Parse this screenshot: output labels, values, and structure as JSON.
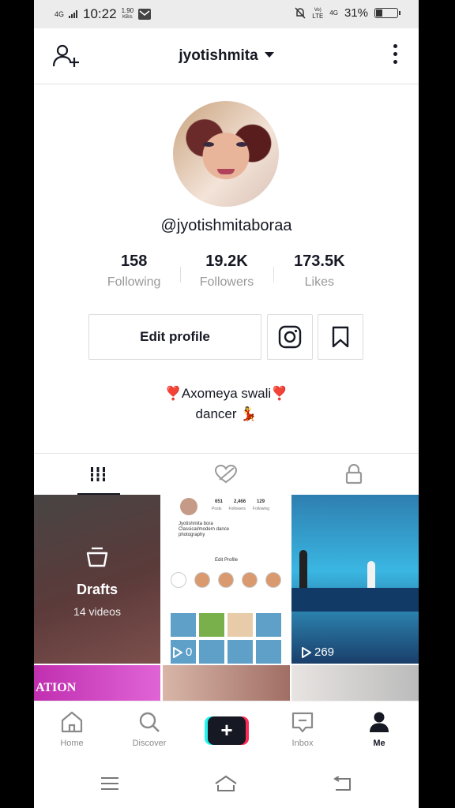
{
  "status_bar": {
    "network_left": "4G",
    "time": "10:22",
    "speed_value": "1.90",
    "speed_unit": "KB/s",
    "network_right_top": "Vo)",
    "network_right_bottom": "LTE",
    "network_right_gen": "4G",
    "battery_percent": "31%",
    "battery_level": 0.31
  },
  "header": {
    "username": "jyotishmita"
  },
  "profile": {
    "handle": "@jyotishmitaboraa",
    "stats": [
      {
        "value": "158",
        "label": "Following"
      },
      {
        "value": "19.2K",
        "label": "Followers"
      },
      {
        "value": "173.5K",
        "label": "Likes"
      }
    ],
    "edit_label": "Edit profile",
    "bio_line1_heart_left": "❣️",
    "bio_line1_text": "Axomeya swali",
    "bio_line1_heart_right": "❣️",
    "bio_line2_text": "dancer",
    "bio_line2_emoji": "💃"
  },
  "tabs": [
    {
      "icon": "grid-icon",
      "active": true
    },
    {
      "icon": "liked-heart-icon",
      "active": false
    },
    {
      "icon": "lock-icon",
      "active": false
    }
  ],
  "videos": {
    "drafts": {
      "title": "Drafts",
      "subtitle": "14 videos"
    },
    "tile2_count": "0",
    "tile3_count": "269",
    "tile4_text": "ATION",
    "mini_profile": {
      "following": "651",
      "followers": "2,466",
      "likes": "129",
      "following_label": "Posts",
      "followers_label": "Followers",
      "likes_label": "Following",
      "name": "Jyotishmita bora",
      "bio1": "Classical/modern dance",
      "bio2": "photography",
      "edit": "Edit Profile"
    }
  },
  "bottom_nav": [
    {
      "label": "Home",
      "icon": "home-icon"
    },
    {
      "label": "Discover",
      "icon": "search-icon"
    },
    {
      "label": "",
      "icon": "create-plus-icon"
    },
    {
      "label": "Inbox",
      "icon": "inbox-icon"
    },
    {
      "label": "Me",
      "icon": "profile-icon",
      "active": true
    }
  ],
  "colors": {
    "text_primary": "#161823",
    "text_secondary": "#999999",
    "brand_cyan": "#25f4ee",
    "brand_pink": "#fe2c55"
  }
}
